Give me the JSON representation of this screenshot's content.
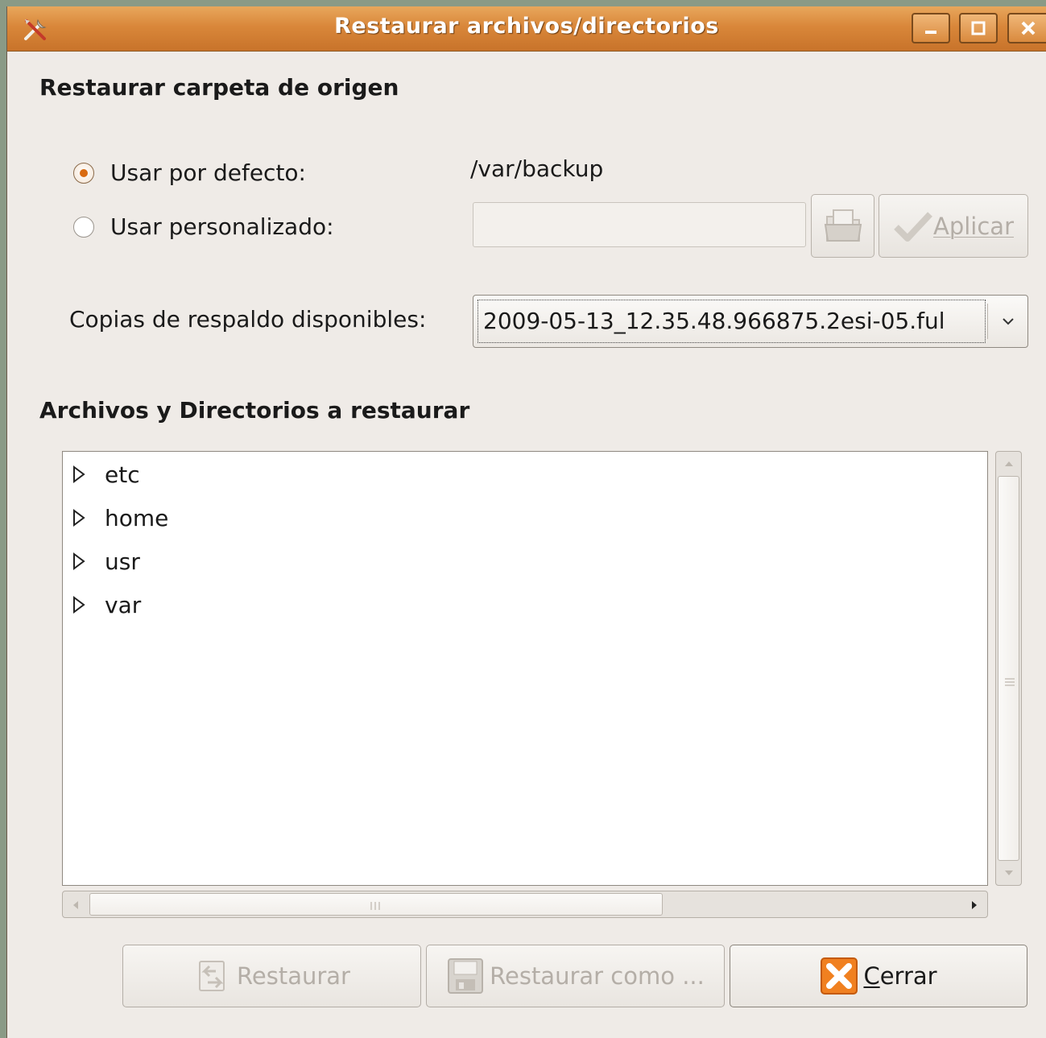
{
  "window": {
    "title": "Restaurar archivos/directorios",
    "icon": "tools-icon",
    "controls": [
      "minimize-icon",
      "maximize-icon",
      "close-icon"
    ]
  },
  "source_section": {
    "heading": "Restaurar carpeta de origen",
    "default_option": {
      "label": "Usar por defecto:",
      "checked": true,
      "value": "/var/backup"
    },
    "custom_option": {
      "label": "Usar personalizado:",
      "checked": false,
      "value": ""
    },
    "folder_button_icon": "folder-icon",
    "apply_button": {
      "label": "Aplicar",
      "icon": "check-icon",
      "enabled": false
    }
  },
  "backups": {
    "label": "Copias de respaldo disponibles:",
    "selected": "2009-05-13_12.35.48.966875.2esi-05.ful"
  },
  "files_section": {
    "heading": "Archivos y Directorios a restaurar",
    "items": [
      {
        "name": "etc"
      },
      {
        "name": "home"
      },
      {
        "name": "usr"
      },
      {
        "name": "var"
      }
    ]
  },
  "buttons": {
    "restore": {
      "label": "Restaurar",
      "enabled": false
    },
    "restore_as": {
      "label": "Restaurar como ...",
      "enabled": false
    },
    "close": {
      "label_first": "C",
      "label_rest": "errar",
      "enabled": true
    }
  }
}
